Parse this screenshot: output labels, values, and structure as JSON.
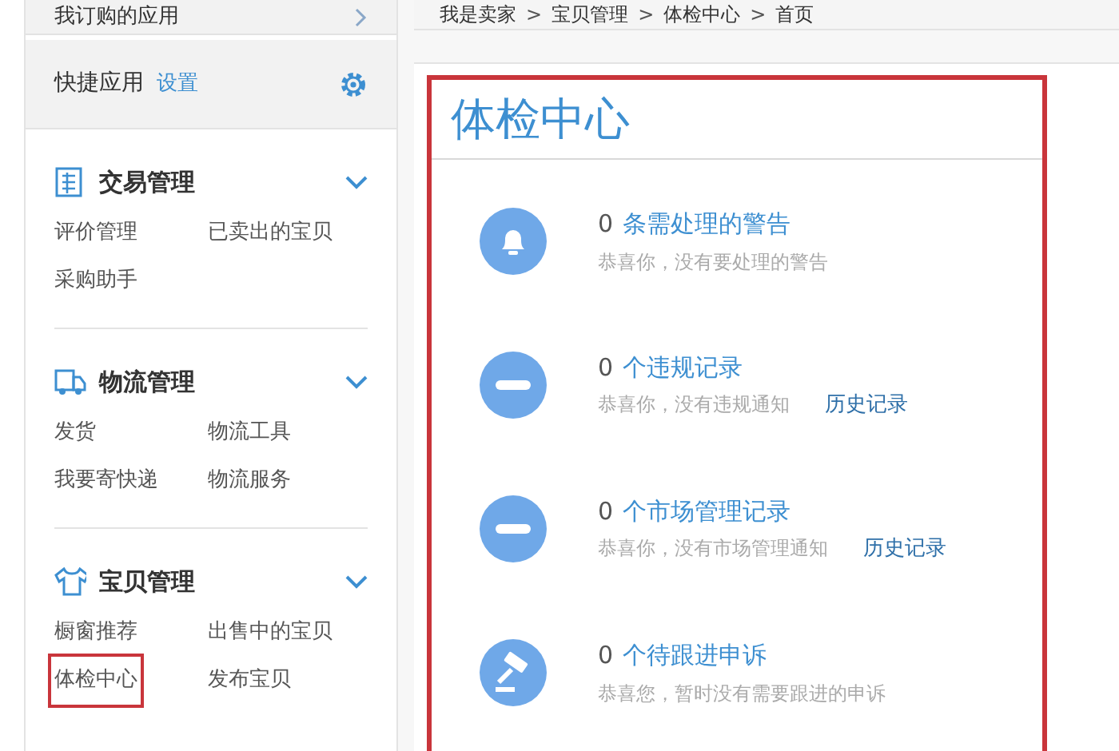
{
  "sidebar": {
    "top_item": {
      "label": "我订购的应用"
    },
    "quick_apps": {
      "label": "快捷应用",
      "settings_link": "设置"
    },
    "sections": [
      {
        "title": "交易管理",
        "kind": "ledger",
        "expanded": true,
        "items": [
          {
            "label": "评价管理",
            "selected": false
          },
          {
            "label": "已卖出的宝贝",
            "selected": false
          },
          {
            "label": "采购助手",
            "selected": false
          }
        ]
      },
      {
        "title": "物流管理",
        "kind": "truck",
        "expanded": true,
        "items": [
          {
            "label": "发货",
            "selected": false
          },
          {
            "label": "物流工具",
            "selected": false
          },
          {
            "label": "我要寄快递",
            "selected": false
          },
          {
            "label": "物流服务",
            "selected": false
          }
        ]
      },
      {
        "title": "宝贝管理",
        "kind": "shirt",
        "expanded": true,
        "items": [
          {
            "label": "橱窗推荐",
            "selected": false
          },
          {
            "label": "出售中的宝贝",
            "selected": false
          },
          {
            "label": "体检中心",
            "selected": true
          },
          {
            "label": "发布宝贝",
            "selected": false
          }
        ]
      }
    ]
  },
  "breadcrumb": [
    "我是卖家",
    "宝贝管理",
    "体检中心",
    "首页"
  ],
  "breadcrumb_separator": ">",
  "panel": {
    "title": "体检中心",
    "highlighted": true,
    "items": [
      {
        "kind": "bell",
        "count": "0",
        "label": "条需处理的警告",
        "description": "恭喜你，没有要处理的警告"
      },
      {
        "kind": "minus",
        "count": "0",
        "label": "个违规记录",
        "description": "恭喜你，没有违规通知",
        "link": "历史记录"
      },
      {
        "kind": "minus",
        "count": "0",
        "label": "个市场管理记录",
        "description": "恭喜你，没有市场管理通知",
        "link": "历史记录"
      },
      {
        "kind": "gavel",
        "count": "0",
        "label": "个待跟进申诉",
        "description": "恭喜您，暂时没有需要跟进的申诉"
      }
    ]
  }
}
